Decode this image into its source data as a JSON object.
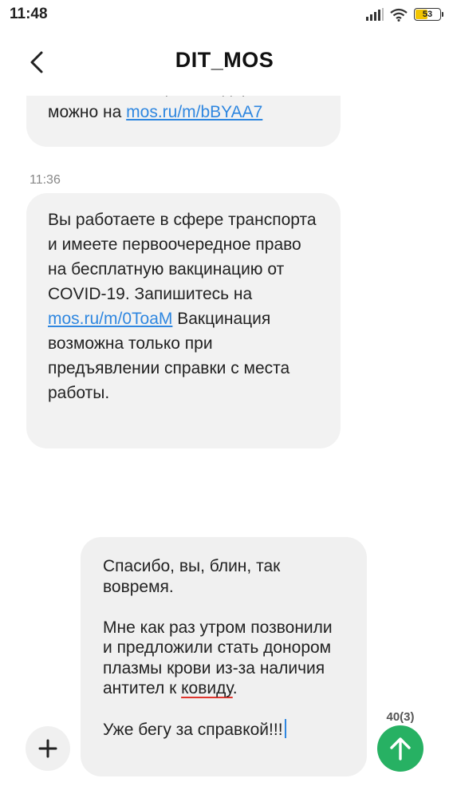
{
  "status_bar": {
    "time": "11:48",
    "battery": "53",
    "battery_level": 0.53,
    "icons": [
      "signal-icon",
      "wifi-icon",
      "battery-icon"
    ]
  },
  "header": {
    "title": "DIT_MOS",
    "back_icon": "chevron-left-icon"
  },
  "messages": [
    {
      "clipped_line": "москвичам защитить здоровье,",
      "text_prefix": "можно на ",
      "link": "mos.ru/m/bBYAA7"
    },
    {
      "timestamp": "11:36",
      "text_before_link": "Вы работаете в сфере транспорта и имеете первоочередное право на бесплатную вакцинацию от COVID-19. Запишитесь на ",
      "link": "mos.ru/m/0ToaM",
      "text_after_link": " Вакцинация возможна только при предъявлении справки с места работы."
    }
  ],
  "composer": {
    "para1": "Спасибо, вы, блин, так вовремя.",
    "para2_before": "Мне как раз утром позвонили и предложили стать донором плазмы крови из-за наличия антител к ",
    "para2_misspelled": "ковиду",
    "para2_after": ".",
    "para3": "Уже бегу за справкой!!!",
    "counter": "40(3)"
  },
  "colors": {
    "link": "#2f87e0",
    "send_button": "#27b163",
    "bubble": "#f2f2f2",
    "spellcheck": "#e0362e",
    "battery": "#f2c500"
  },
  "icons": {
    "add": "plus-icon",
    "send": "arrow-up-icon"
  }
}
